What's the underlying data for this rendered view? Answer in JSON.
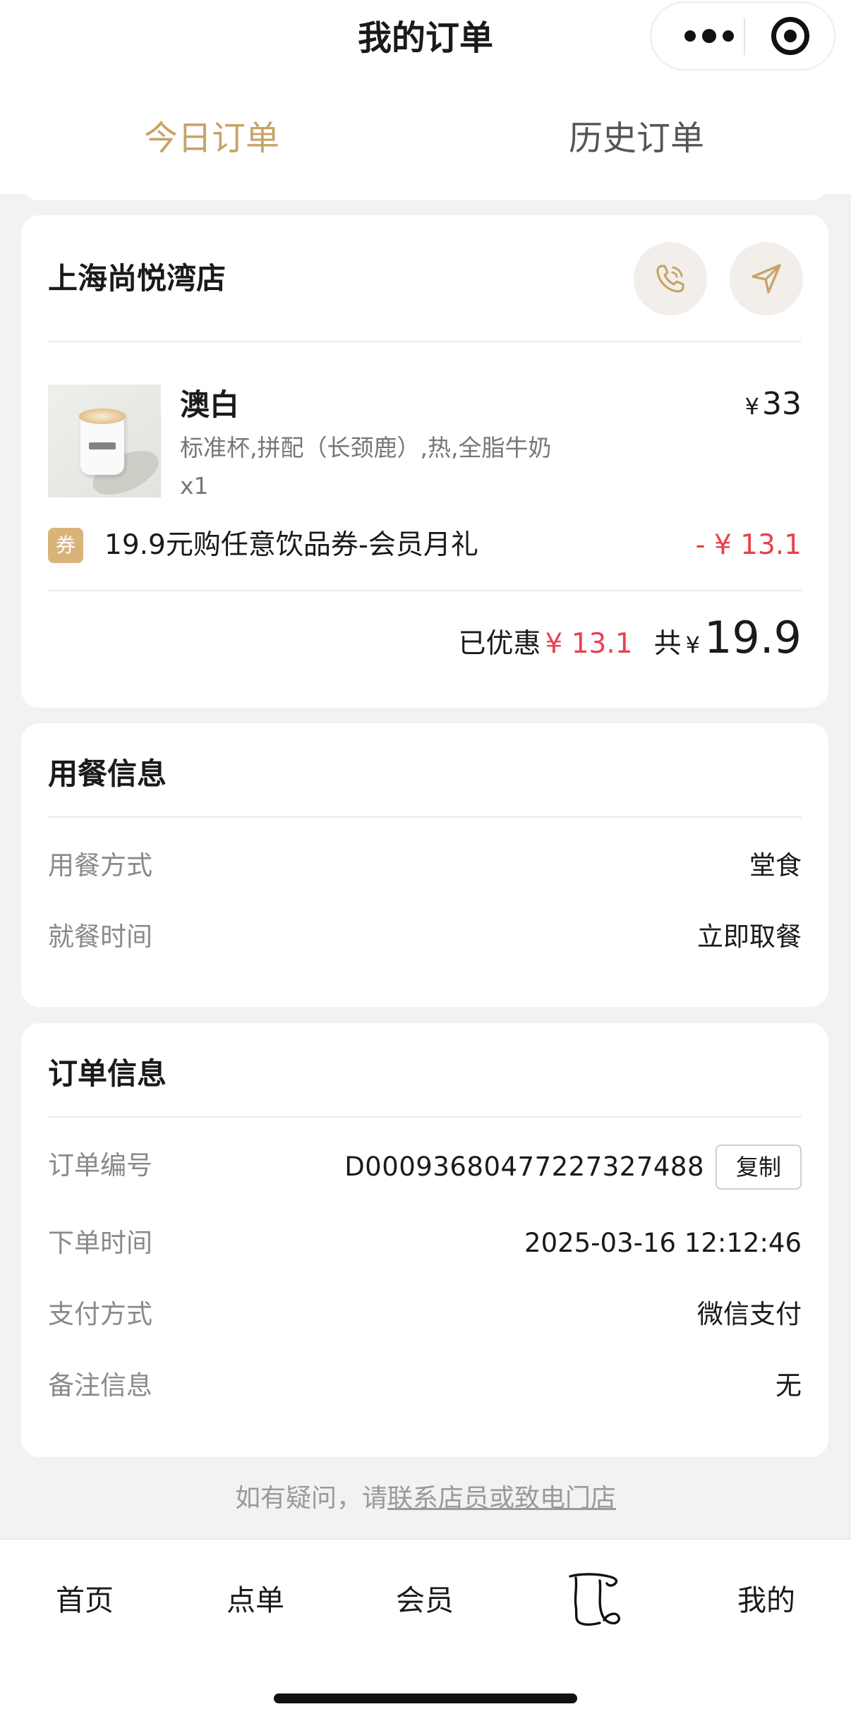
{
  "header": {
    "title": "我的订单",
    "tabs": [
      {
        "label": "今日订单",
        "active": true
      },
      {
        "label": "历史订单",
        "active": false
      }
    ],
    "capsule": {
      "more_icon": "more-dots-icon",
      "close_icon": "target-icon"
    }
  },
  "colors": {
    "accent": "#c8a367",
    "discount_red": "#e8414f",
    "coupon_badge": "#d9b47a"
  },
  "order": {
    "store_name": "上海尚悦湾店",
    "phone_icon": "phone-icon",
    "navigate_icon": "navigate-arrow-icon",
    "item": {
      "name": "澳白",
      "spec": "标准杯,拼配（长颈鹿）,热,全脂牛奶",
      "qty": "x1",
      "currency": "¥",
      "price": "33"
    },
    "coupon": {
      "badge": "券",
      "text": "19.9元购任意饮品券-会员月礼",
      "discount": "- ¥ 13.1"
    },
    "totals": {
      "saved_label": "已优惠",
      "saved_amount": "¥ 13.1",
      "total_label": "共",
      "currency": "¥",
      "total_amount": "19.9"
    }
  },
  "dining": {
    "title": "用餐信息",
    "rows": [
      {
        "label": "用餐方式",
        "value": "堂食"
      },
      {
        "label": "就餐时间",
        "value": "立即取餐"
      }
    ]
  },
  "order_info": {
    "title": "订单信息",
    "order_no_label": "订单编号",
    "order_no": "D00093680477227327488",
    "copy_label": "复制",
    "rows": [
      {
        "label": "下单时间",
        "value": "2025-03-16 12:12:46"
      },
      {
        "label": "支付方式",
        "value": "微信支付"
      },
      {
        "label": "备注信息",
        "value": "无"
      }
    ]
  },
  "help": {
    "prefix": "如有疑问，请",
    "link": "联系店员或致电门店"
  },
  "tabbar": {
    "items": [
      "首页",
      "点单",
      "会员",
      "我的"
    ],
    "orders_icon": "order-scroll-icon"
  }
}
